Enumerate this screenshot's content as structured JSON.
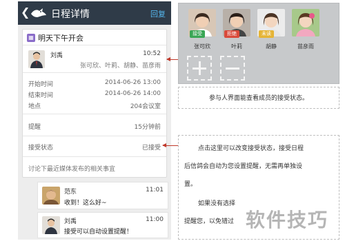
{
  "header": {
    "back_glyph": "❮",
    "title": "日程详情",
    "reply": "回复",
    "bird_icon": "bird-logo-icon"
  },
  "event": {
    "title": "明天下午开会",
    "organizer": "刘禹",
    "time": "10:52",
    "members": "张可欣、叶莉、胡静、苗彦雨",
    "rows": [
      {
        "label": "开始时间",
        "value": "2014-06-26 13:00"
      },
      {
        "label": "结束时间",
        "value": "2014-06-26 14:00"
      },
      {
        "label": "地点",
        "value": "204会议室"
      },
      {
        "label": "提醒",
        "value": "15分钟前"
      },
      {
        "label": "接受状态",
        "value": "已接受"
      }
    ],
    "footer": "讨论下最近媒体发布的相关事宜"
  },
  "comments": [
    {
      "name": "范东",
      "time": "11:01",
      "text": "收到！这么好~"
    },
    {
      "name": "刘禹",
      "time": "11:00",
      "text": "接受可以自动设置提醒！"
    }
  ],
  "members_panel": {
    "members": [
      {
        "name": "张可欣",
        "badge": "接受",
        "badge_color": "#3aa655"
      },
      {
        "name": "叶莉",
        "badge": "拒绝",
        "badge_color": "#d94a3b"
      },
      {
        "name": "胡静",
        "badge": "未读",
        "badge_color": "#e5b436"
      },
      {
        "name": "苗彦雨",
        "badge": "",
        "badge_color": ""
      }
    ]
  },
  "notes": {
    "note1": "参与人界面能查看成员的接受状态。",
    "note2_p1": "点击这里可以改变接受状态，接受日程",
    "note2_p2": "后信鸽会自动为您设置提醒，无需再单独设",
    "note2_p3": "置。",
    "note2_p4": "如果没有选择",
    "note2_p5": "提醒您，以免错过"
  },
  "watermark": "软件技巧"
}
